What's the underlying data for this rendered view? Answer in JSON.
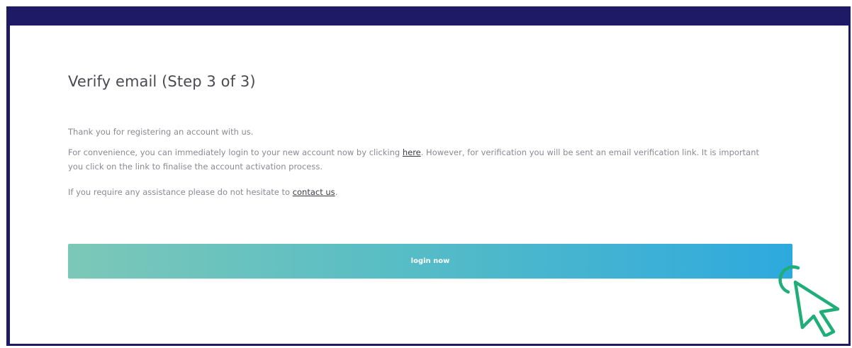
{
  "page": {
    "title": "Verify email (Step 3 of 3)",
    "paragraph1": "Thank you for registering an account with us.",
    "paragraph2_before_link": "For convenience, you can immediately login to your new account now by clicking ",
    "paragraph2_link": "here",
    "paragraph2_after_link": ". However, for verification you will be sent an email verification link. It is important you click on the link to finalise the account activation process.",
    "paragraph3_before_link": "If you require any assistance please do not hesitate to ",
    "paragraph3_link": "contact us",
    "paragraph3_after_link": "."
  },
  "button": {
    "label": "login now"
  },
  "icons": {
    "cursor": "pointer-click-icon"
  },
  "colors": {
    "frame": "#1e1a66",
    "button_gradient_start": "#7cc8b8",
    "button_gradient_end": "#2ea9de",
    "cursor": "#1fae7a"
  }
}
